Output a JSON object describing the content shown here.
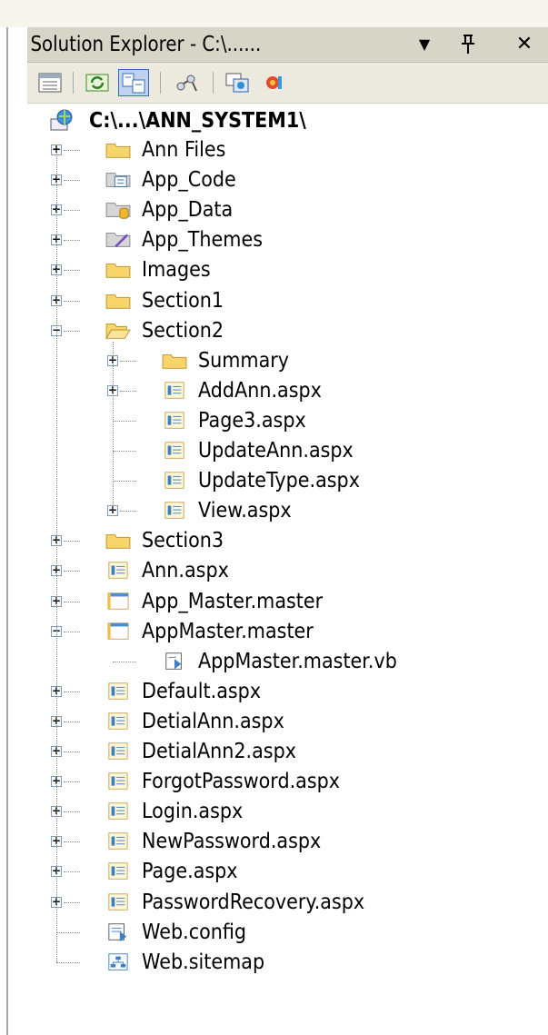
{
  "window": {
    "title": "Solution Explorer - C:\\...... ",
    "dropdown_glyph": "▼",
    "pin_glyph": "ᵖ",
    "close_glyph": "✕"
  },
  "toolbar": {
    "buttons": [
      {
        "name": "properties-icon",
        "active": false
      },
      {
        "name": "refresh-icon",
        "active": false
      },
      {
        "name": "nest-related-files-icon",
        "active": true
      },
      {
        "name": "view-class-diagram-icon",
        "active": false
      },
      {
        "name": "copy-website-icon",
        "active": false
      },
      {
        "name": "asp-net-configuration-icon",
        "active": false
      }
    ]
  },
  "tree": {
    "root": {
      "label": "C:\\...\\ANN_SYSTEM1\\",
      "icon": "website-globe-icon"
    },
    "items": [
      {
        "label": "Ann Files",
        "icon": "folder-icon",
        "level": 1,
        "expander": "plus"
      },
      {
        "label": "App_Code",
        "icon": "app-code-folder-icon",
        "level": 1,
        "expander": "plus"
      },
      {
        "label": "App_Data",
        "icon": "app-data-folder-icon",
        "level": 1,
        "expander": "plus"
      },
      {
        "label": "App_Themes",
        "icon": "app-themes-folder-icon",
        "level": 1,
        "expander": "plus"
      },
      {
        "label": "Images",
        "icon": "folder-icon",
        "level": 1,
        "expander": "plus"
      },
      {
        "label": "Section1",
        "icon": "folder-icon",
        "level": 1,
        "expander": "plus"
      },
      {
        "label": "Section2",
        "icon": "open-folder-icon",
        "level": 1,
        "expander": "minus"
      },
      {
        "label": "Summary",
        "icon": "folder-icon",
        "level": 2,
        "expander": "plus"
      },
      {
        "label": "AddAnn.aspx",
        "icon": "aspx-page-icon",
        "level": 2,
        "expander": "plus"
      },
      {
        "label": "Page3.aspx",
        "icon": "aspx-page-icon",
        "level": 2,
        "expander": "none"
      },
      {
        "label": "UpdateAnn.aspx",
        "icon": "aspx-page-icon",
        "level": 2,
        "expander": "none"
      },
      {
        "label": "UpdateType.aspx",
        "icon": "aspx-page-icon",
        "level": 2,
        "expander": "none"
      },
      {
        "label": "View.aspx",
        "icon": "aspx-page-icon",
        "level": 2,
        "expander": "plus"
      },
      {
        "label": "Section3",
        "icon": "folder-icon",
        "level": 1,
        "expander": "plus"
      },
      {
        "label": "Ann.aspx",
        "icon": "aspx-page-icon",
        "level": 1,
        "expander": "plus"
      },
      {
        "label": "App_Master.master",
        "icon": "master-page-icon",
        "level": 1,
        "expander": "plus"
      },
      {
        "label": "AppMaster.master",
        "icon": "master-page-icon",
        "level": 1,
        "expander": "minus"
      },
      {
        "label": "AppMaster.master.vb",
        "icon": "vb-code-file-icon",
        "level": 2,
        "expander": "none"
      },
      {
        "label": "Default.aspx",
        "icon": "aspx-page-icon",
        "level": 1,
        "expander": "plus"
      },
      {
        "label": "DetialAnn.aspx",
        "icon": "aspx-page-icon",
        "level": 1,
        "expander": "plus"
      },
      {
        "label": "DetialAnn2.aspx",
        "icon": "aspx-page-icon",
        "level": 1,
        "expander": "plus"
      },
      {
        "label": "ForgotPassword.aspx",
        "icon": "aspx-page-icon",
        "level": 1,
        "expander": "plus"
      },
      {
        "label": "Login.aspx",
        "icon": "aspx-page-icon",
        "level": 1,
        "expander": "plus"
      },
      {
        "label": "NewPassword.aspx",
        "icon": "aspx-page-icon",
        "level": 1,
        "expander": "plus"
      },
      {
        "label": "Page.aspx",
        "icon": "aspx-page-icon",
        "level": 1,
        "expander": "plus"
      },
      {
        "label": "PasswordRecovery.aspx",
        "icon": "aspx-page-icon",
        "level": 1,
        "expander": "plus"
      },
      {
        "label": "Web.config",
        "icon": "web-config-icon",
        "level": 1,
        "expander": "none"
      },
      {
        "label": "Web.sitemap",
        "icon": "sitemap-icon",
        "level": 1,
        "expander": "none"
      }
    ]
  },
  "colors": {
    "title_bar": "#d7d5c8",
    "toolbar": "#eceadf",
    "active_button": "#c1d2ee",
    "folder_yellow": "#f7d56b",
    "page_blue": "#3c7fc3"
  }
}
